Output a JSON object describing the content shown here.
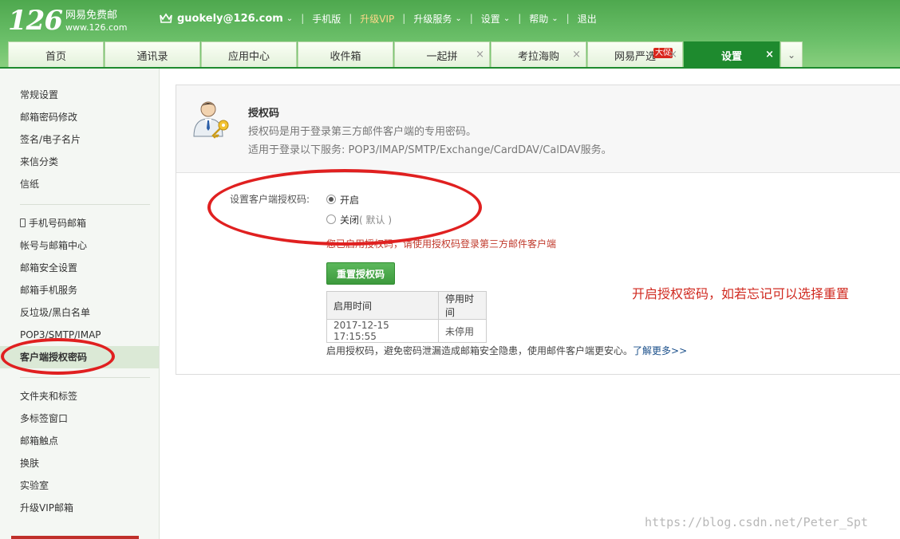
{
  "header": {
    "logo_number": "126",
    "logo_cn": "网易免费邮",
    "logo_url": "www.126.com",
    "user": "guokely@126.com",
    "mobile": "手机版",
    "vip": "升级VIP",
    "upgrade": "升级服务",
    "settings": "设置",
    "help": "帮助",
    "logout": "退出",
    "sep": "|"
  },
  "tabs": [
    {
      "label": "首页",
      "closable": false
    },
    {
      "label": "通讯录",
      "closable": false
    },
    {
      "label": "应用中心",
      "closable": false
    },
    {
      "label": "收件箱",
      "closable": false
    },
    {
      "label": "一起拼",
      "closable": true
    },
    {
      "label": "考拉海购",
      "closable": true
    },
    {
      "label": "网易严选",
      "closable": true,
      "badge": "大促"
    },
    {
      "label": "设置",
      "closable": true,
      "active": true
    }
  ],
  "sidebar": {
    "group1": [
      "常规设置",
      "邮箱密码修改",
      "签名/电子名片",
      "来信分类",
      "信纸"
    ],
    "group2": [
      "手机号码邮箱",
      "帐号与邮箱中心",
      "邮箱安全设置",
      "邮箱手机服务",
      "反垃圾/黑白名单",
      "POP3/SMTP/IMAP",
      "客户端授权密码"
    ],
    "group3": [
      "文件夹和标签",
      "多标签窗口",
      "邮箱触点",
      "换肤",
      "实验室",
      "升级VIP邮箱"
    ]
  },
  "panel": {
    "title": "授权码",
    "desc1": "授权码是用于登录第三方邮件客户端的专用密码。",
    "desc2": "适用于登录以下服务: POP3/IMAP/SMTP/Exchange/CardDAV/CalDAV服务。",
    "form_label": "设置客户端授权码:",
    "radio_on": "开启",
    "radio_off": "关闭",
    "radio_off_hint": "( 默认 )",
    "selected": "开启",
    "notice": "您已启用授权码，请使用授权码登录第三方邮件客户端",
    "reset_button": "重置授权码",
    "table": {
      "headers": [
        "启用时间",
        "停用时间"
      ],
      "row": [
        "2017-12-15 17:15:55",
        "未停用"
      ]
    },
    "tip": "启用授权码，避免密码泄漏造成邮箱安全隐患，使用邮件客户端更安心。",
    "tip_link": "了解更多>>"
  },
  "annotation": "开启授权密码，如若忘记可以选择重置",
  "watermark": "https://blog.csdn.net/Peter_Spt",
  "colors": {
    "header_green": "#4ea84e",
    "active_tab": "#1e8a2e",
    "annotation_red": "#d02a20"
  }
}
